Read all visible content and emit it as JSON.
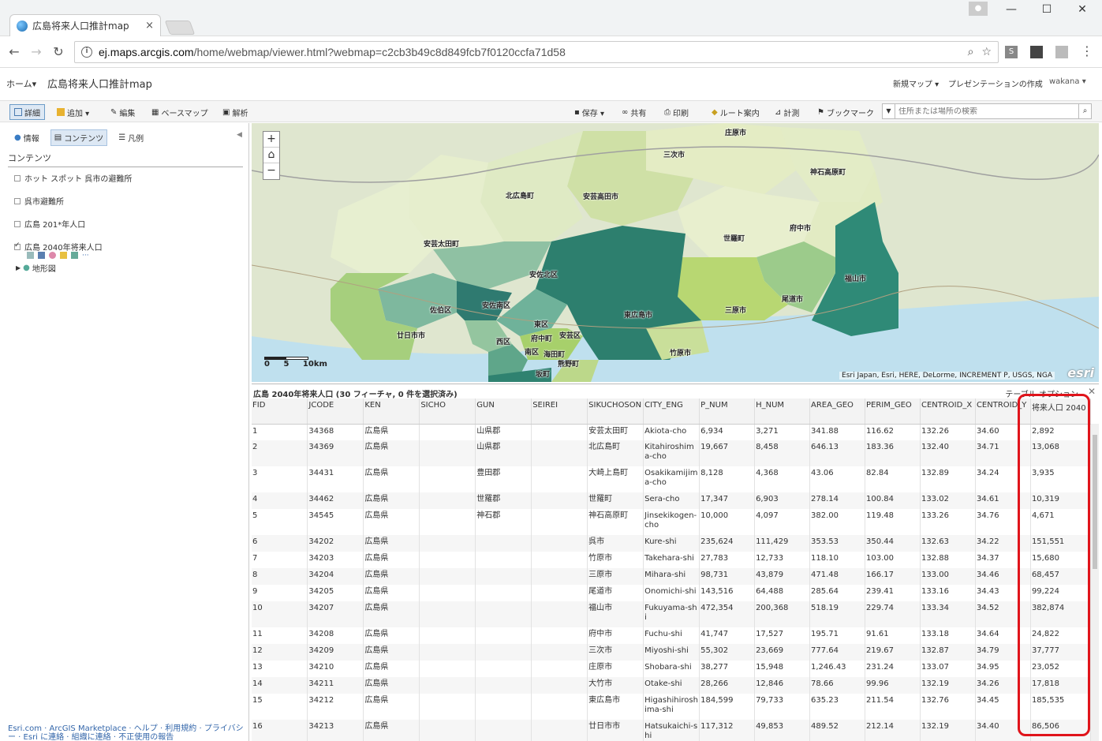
{
  "browser": {
    "tab_title": "広島将来人口推計map",
    "tab_close": "×",
    "url_host": "ej.maps.arcgis.com",
    "url_path": "/home/webmap/viewer.html?webmap=c2cb3b49c8d849fcb7f0120ccfa71d58",
    "ext_s": "S"
  },
  "header": {
    "home": "ホーム▾",
    "title": "広島将来人口推計map",
    "new_map": "新規マップ ▾",
    "create_presentation": "プレゼンテーションの作成",
    "user": "wakana ▾"
  },
  "toolbar": {
    "details": "詳細",
    "add": "追加 ▾",
    "edit": "編集",
    "basemap": "ベースマップ",
    "analysis": "解析",
    "save": "保存 ▾",
    "share": "共有",
    "print": "印刷",
    "directions": "ルート案内",
    "measure": "計測",
    "bookmarks": "ブックマーク",
    "search_placeholder": "住所または場所の検索"
  },
  "leftpanel": {
    "tab_info": "情報",
    "tab_content": "コンテンツ",
    "tab_legend": "凡例",
    "heading": "コンテンツ",
    "layers": [
      {
        "label": "ホット スポット 呉市の避難所",
        "checked": false
      },
      {
        "label": "呉市避難所",
        "checked": false
      },
      {
        "label": "広島 201*年人口",
        "checked": false
      },
      {
        "label": "広島 2040年将来人口",
        "checked": true
      }
    ],
    "basemap_layer": "地形図",
    "footer_line1": "Esri.com · ArcGIS Marketplace · ヘルプ · 利用規約 · プライバシー · Esri に連絡 · 組織に連絡 · 不正使用の報告"
  },
  "map": {
    "labels": [
      "庄原市",
      "三次市",
      "神石高原町",
      "北広島町",
      "安芸高田市",
      "府中市",
      "世羅町",
      "安芸太田町",
      "安佐北区",
      "福山市",
      "尾道市",
      "三原市",
      "佐伯区",
      "安佐南区",
      "東広島市",
      "廿日市市",
      "東区",
      "府中町",
      "安芸区",
      "西区",
      "南区",
      "海田町",
      "竹原市",
      "熊野町",
      "坂町"
    ],
    "scale_labels": [
      "0",
      "5",
      "10km"
    ],
    "attribution": "Esri Japan, Esri, HERE, DeLorme, INCREMENT P, USGS, NGA",
    "esri_logo": "esri"
  },
  "table": {
    "title": "広島 2040年将来人口 (30 フィーチャ, 0 件を選択済み)",
    "options": "テーブル オプション",
    "columns": [
      "FID",
      "JCODE",
      "KEN",
      "SICHO",
      "GUN",
      "SEIREI",
      "SIKUCHOSON",
      "CITY_ENG",
      "P_NUM",
      "H_NUM",
      "AREA_GEO",
      "PERIM_GEO",
      "CENTROID_X",
      "CENTROID_Y",
      "将来人口 2040"
    ],
    "rows": [
      [
        "1",
        "34368",
        "広島県",
        "",
        "山県郡",
        "",
        "安芸太田町",
        "Akiota-cho",
        "6,934",
        "3,271",
        "341.88",
        "116.62",
        "132.26",
        "34.60",
        "2,892"
      ],
      [
        "2",
        "34369",
        "広島県",
        "",
        "山県郡",
        "",
        "北広島町",
        "Kitahiroshima-cho",
        "19,667",
        "8,458",
        "646.13",
        "183.36",
        "132.40",
        "34.71",
        "13,068"
      ],
      [
        "3",
        "34431",
        "広島県",
        "",
        "豊田郡",
        "",
        "大崎上島町",
        "Osakikamijima-cho",
        "8,128",
        "4,368",
        "43.06",
        "82.84",
        "132.89",
        "34.24",
        "3,935"
      ],
      [
        "4",
        "34462",
        "広島県",
        "",
        "世羅郡",
        "",
        "世羅町",
        "Sera-cho",
        "17,347",
        "6,903",
        "278.14",
        "100.84",
        "133.02",
        "34.61",
        "10,319"
      ],
      [
        "5",
        "34545",
        "広島県",
        "",
        "神石郡",
        "",
        "神石高原町",
        "Jinsekikogen-cho",
        "10,000",
        "4,097",
        "382.00",
        "119.48",
        "133.26",
        "34.76",
        "4,671"
      ],
      [
        "6",
        "34202",
        "広島県",
        "",
        "",
        "",
        "呉市",
        "Kure-shi",
        "235,624",
        "111,429",
        "353.53",
        "350.44",
        "132.63",
        "34.22",
        "151,551"
      ],
      [
        "7",
        "34203",
        "広島県",
        "",
        "",
        "",
        "竹原市",
        "Takehara-shi",
        "27,783",
        "12,733",
        "118.10",
        "103.00",
        "132.88",
        "34.37",
        "15,680"
      ],
      [
        "8",
        "34204",
        "広島県",
        "",
        "",
        "",
        "三原市",
        "Mihara-shi",
        "98,731",
        "43,879",
        "471.48",
        "166.17",
        "133.00",
        "34.46",
        "68,457"
      ],
      [
        "9",
        "34205",
        "広島県",
        "",
        "",
        "",
        "尾道市",
        "Onomichi-shi",
        "143,516",
        "64,488",
        "285.64",
        "239.41",
        "133.16",
        "34.43",
        "99,224"
      ],
      [
        "10",
        "34207",
        "広島県",
        "",
        "",
        "",
        "福山市",
        "Fukuyama-shi",
        "472,354",
        "200,368",
        "518.19",
        "229.74",
        "133.34",
        "34.52",
        "382,874"
      ],
      [
        "11",
        "34208",
        "広島県",
        "",
        "",
        "",
        "府中市",
        "Fuchu-shi",
        "41,747",
        "17,527",
        "195.71",
        "91.61",
        "133.18",
        "34.64",
        "24,822"
      ],
      [
        "12",
        "34209",
        "広島県",
        "",
        "",
        "",
        "三次市",
        "Miyoshi-shi",
        "55,302",
        "23,669",
        "777.64",
        "219.67",
        "132.87",
        "34.79",
        "37,777"
      ],
      [
        "13",
        "34210",
        "広島県",
        "",
        "",
        "",
        "庄原市",
        "Shobara-shi",
        "38,277",
        "15,948",
        "1,246.43",
        "231.24",
        "133.07",
        "34.95",
        "23,052"
      ],
      [
        "14",
        "34211",
        "広島県",
        "",
        "",
        "",
        "大竹市",
        "Otake-shi",
        "28,266",
        "12,846",
        "78.66",
        "99.96",
        "132.19",
        "34.26",
        "17,818"
      ],
      [
        "15",
        "34212",
        "広島県",
        "",
        "",
        "",
        "東広島市",
        "Higashihiroshima-shi",
        "184,599",
        "79,733",
        "635.23",
        "211.54",
        "132.76",
        "34.45",
        "185,535"
      ],
      [
        "16",
        "34213",
        "広島県",
        "",
        "",
        "",
        "廿日市市",
        "Hatsukaichi-shi",
        "117,312",
        "49,853",
        "489.52",
        "212.14",
        "132.19",
        "34.40",
        "86,506"
      ]
    ]
  }
}
